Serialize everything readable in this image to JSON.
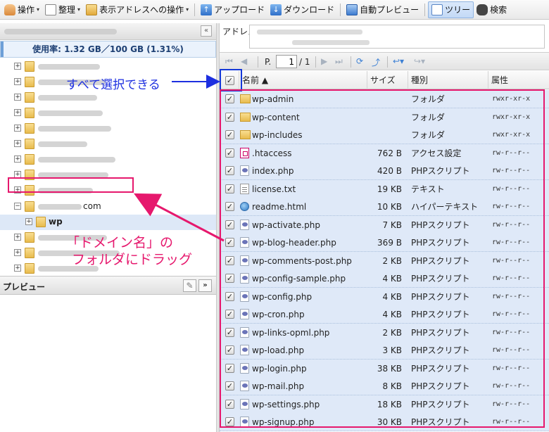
{
  "toolbar": {
    "items": [
      {
        "label": "操作",
        "caret": "▾",
        "icon": "hand-icon"
      },
      {
        "label": "整理",
        "caret": "▾",
        "icon": "document-icon"
      },
      {
        "label": "表示アドレスへの操作",
        "caret": "▾",
        "icon": "address-icon"
      },
      {
        "label": "アップロード",
        "icon": "upload-icon"
      },
      {
        "label": "ダウンロード",
        "icon": "download-icon"
      },
      {
        "label": "自動プレビュー",
        "icon": "monitor-icon"
      },
      {
        "label": "ツリー",
        "icon": "tree-icon",
        "active": true
      },
      {
        "label": "検索",
        "icon": "binoculars-icon"
      }
    ]
  },
  "left": {
    "collapse": "«",
    "usage": "使用率: 1.32 GB／100 GB (1.31%)",
    "tree": {
      "domain_suffix": "com",
      "child_label": "wp"
    },
    "preview": {
      "title": "プレビュー",
      "expand": "»"
    }
  },
  "right": {
    "address_label": "アドレス",
    "pager": {
      "page_prefix": "P.",
      "page_value": "1",
      "page_total": "/ 1"
    },
    "columns": {
      "name": "名前 ▲",
      "size": "サイズ",
      "type": "種別",
      "attr": "属性"
    },
    "files": [
      {
        "name": "wp-admin",
        "size": "",
        "type": "フォルダ",
        "attr": "rwxr-xr-x",
        "icon": "folder"
      },
      {
        "name": "wp-content",
        "size": "",
        "type": "フォルダ",
        "attr": "rwxr-xr-x",
        "icon": "folder"
      },
      {
        "name": "wp-includes",
        "size": "",
        "type": "フォルダ",
        "attr": "rwxr-xr-x",
        "icon": "folder"
      },
      {
        "name": ".htaccess",
        "size": "762 B",
        "type": "アクセス設定",
        "attr": "rw-r--r--",
        "icon": "htaccess"
      },
      {
        "name": "index.php",
        "size": "420 B",
        "type": "PHPスクリプト",
        "attr": "rw-r--r--",
        "icon": "php"
      },
      {
        "name": "license.txt",
        "size": "19 KB",
        "type": "テキスト",
        "attr": "rw-r--r--",
        "icon": "text"
      },
      {
        "name": "readme.html",
        "size": "10 KB",
        "type": "ハイパーテキスト",
        "attr": "rw-r--r--",
        "icon": "html"
      },
      {
        "name": "wp-activate.php",
        "size": "7 KB",
        "type": "PHPスクリプト",
        "attr": "rw-r--r--",
        "icon": "php"
      },
      {
        "name": "wp-blog-header.php",
        "size": "369 B",
        "type": "PHPスクリプト",
        "attr": "rw-r--r--",
        "icon": "php"
      },
      {
        "name": "wp-comments-post.php",
        "size": "2 KB",
        "type": "PHPスクリプト",
        "attr": "rw-r--r--",
        "icon": "php"
      },
      {
        "name": "wp-config-sample.php",
        "size": "4 KB",
        "type": "PHPスクリプト",
        "attr": "rw-r--r--",
        "icon": "php"
      },
      {
        "name": "wp-config.php",
        "size": "4 KB",
        "type": "PHPスクリプト",
        "attr": "rw-r--r--",
        "icon": "php"
      },
      {
        "name": "wp-cron.php",
        "size": "4 KB",
        "type": "PHPスクリプト",
        "attr": "rw-r--r--",
        "icon": "php"
      },
      {
        "name": "wp-links-opml.php",
        "size": "2 KB",
        "type": "PHPスクリプト",
        "attr": "rw-r--r--",
        "icon": "php"
      },
      {
        "name": "wp-load.php",
        "size": "3 KB",
        "type": "PHPスクリプト",
        "attr": "rw-r--r--",
        "icon": "php"
      },
      {
        "name": "wp-login.php",
        "size": "38 KB",
        "type": "PHPスクリプト",
        "attr": "rw-r--r--",
        "icon": "php"
      },
      {
        "name": "wp-mail.php",
        "size": "8 KB",
        "type": "PHPスクリプト",
        "attr": "rw-r--r--",
        "icon": "php"
      },
      {
        "name": "wp-settings.php",
        "size": "18 KB",
        "type": "PHPスクリプト",
        "attr": "rw-r--r--",
        "icon": "php"
      },
      {
        "name": "wp-signup.php",
        "size": "30 KB",
        "type": "PHPスクリプト",
        "attr": "rw-r--r--",
        "icon": "php"
      }
    ]
  },
  "annotations": {
    "select_all": "すべて選択できる",
    "drag_line1": "「ドメイン名」の",
    "drag_line2": "フォルダにドラッグ",
    "blue": "#1d2fe0",
    "pink": "#e6186d"
  }
}
